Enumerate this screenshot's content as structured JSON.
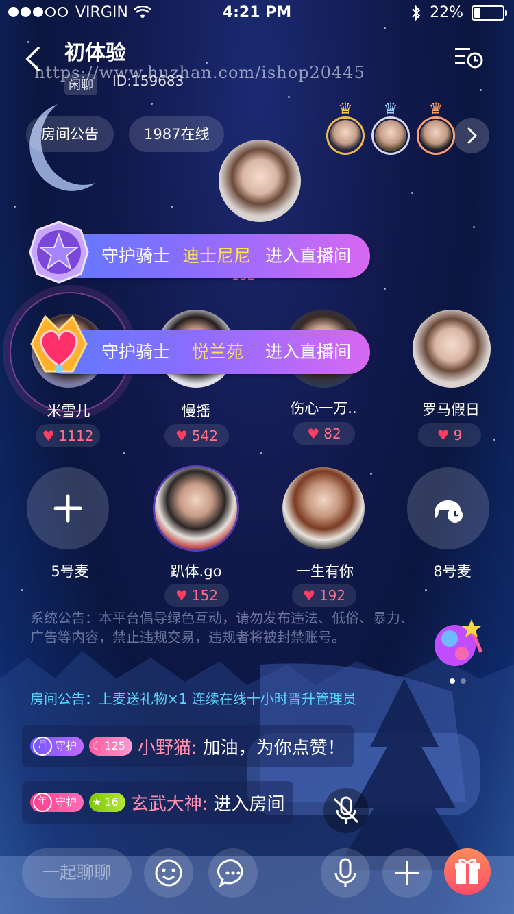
{
  "status_bar": {
    "carrier": "VIRGIN",
    "time": "4:21 PM",
    "battery": "22%",
    "battery_level": 0.22
  },
  "header": {
    "title": "初体验",
    "tag": "闲聊",
    "room_id": "ID:159683",
    "watermark": "https://www.huzhan.com/ishop20445"
  },
  "chips": {
    "notice": "房间公告",
    "online": "1987在线"
  },
  "banners": [
    {
      "prefix": "守护骑士",
      "name": "迪士尼尼",
      "action": "进入直播间"
    },
    {
      "prefix": "守护骑士",
      "name": "悦兰苑",
      "action": "进入直播间"
    }
  ],
  "host_likes_peek": "152",
  "seats_row1": [
    {
      "name": "米雪儿",
      "likes": "1112"
    },
    {
      "name": "慢摇",
      "likes": "542"
    },
    {
      "name": "伤心一万..",
      "likes": "82"
    },
    {
      "name": "罗马假日",
      "likes": "9"
    }
  ],
  "seats_row2": [
    {
      "name": "5号麦",
      "likes": ""
    },
    {
      "name": "趴体.go",
      "likes": "152"
    },
    {
      "name": "一生有你",
      "likes": "192"
    },
    {
      "name": "8号麦",
      "likes": ""
    }
  ],
  "system_notice": "系统公告：本平台倡导绿色互动，请勿发布违法、低俗、暴力、广告等内容，禁止违规交易，违规者将被封禁账号。",
  "room_notice": "房间公告：上麦送礼物×1   连续在线十小时晋升管理员",
  "chat": [
    {
      "level_char": "月",
      "role": "守护",
      "points": "125",
      "user": "小野猫:",
      "message": "加油，为你点赞！"
    },
    {
      "level_char": "年",
      "role": "守护",
      "points": "16",
      "user": "玄武大神:",
      "message": "进入房间"
    }
  ],
  "input": {
    "placeholder": "一起聊聊"
  },
  "colors": {
    "accent_pink": "#ff3d63",
    "banner_gold": "#ffe15a",
    "notice_cyan": "#5ad6ff"
  }
}
